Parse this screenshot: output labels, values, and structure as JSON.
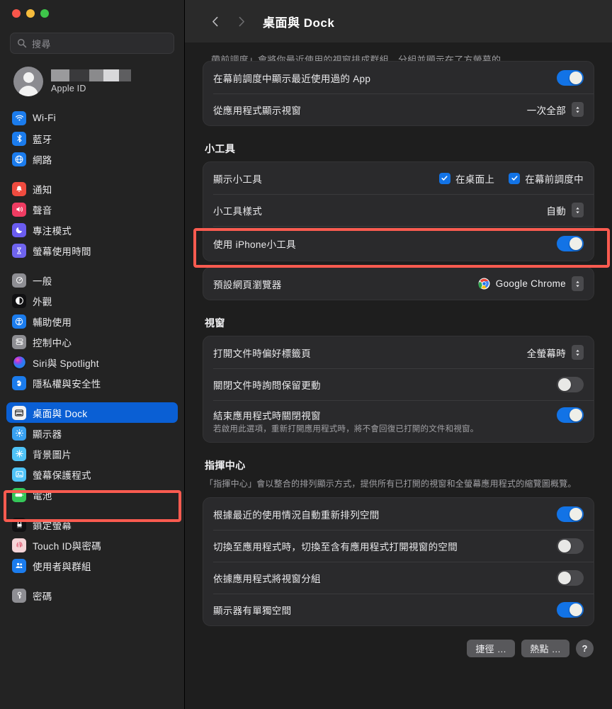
{
  "window": {
    "traffic_lights": [
      "close",
      "minimize",
      "zoom"
    ]
  },
  "sidebar": {
    "search": {
      "placeholder": "搜尋",
      "icon": "search-icon"
    },
    "account": {
      "name_redacted": true,
      "subtitle": "Apple ID"
    },
    "groups": [
      {
        "items": [
          {
            "label": "Wi-Fi",
            "icon": "wifi-icon",
            "color": "#1b7ced"
          },
          {
            "label": "藍牙",
            "icon": "bluetooth-icon",
            "color": "#1b7ced"
          },
          {
            "label": "網路",
            "icon": "network-globe-icon",
            "color": "#1b7ced"
          }
        ]
      },
      {
        "items": [
          {
            "label": "通知",
            "icon": "notifications-bell-icon",
            "color": "#ef4b3f"
          },
          {
            "label": "聲音",
            "icon": "sound-speaker-icon",
            "color": "#ef3c62"
          },
          {
            "label": "專注模式",
            "icon": "focus-moon-icon",
            "color": "#6a5cf0"
          },
          {
            "label": "螢幕使用時間",
            "icon": "screen-time-hourglass-icon",
            "color": "#6f64ef"
          }
        ]
      },
      {
        "items": [
          {
            "label": "一般",
            "icon": "general-gear-icon",
            "color": "#8e8e93"
          },
          {
            "label": "外觀",
            "icon": "appearance-contrast-icon",
            "color": "#111113"
          },
          {
            "label": "輔助使用",
            "icon": "accessibility-icon",
            "color": "#1b7ced"
          },
          {
            "label": "控制中心",
            "icon": "control-center-icon",
            "color": "#8e8e93"
          },
          {
            "label": "Siri與 Spotlight",
            "icon": "siri-icon",
            "color": "#b93ab5"
          },
          {
            "label": "隱私權與安全性",
            "icon": "privacy-hand-icon",
            "color": "#1b7ced"
          }
        ]
      },
      {
        "items": [
          {
            "label": "桌面與 Dock",
            "icon": "desktop-dock-icon",
            "color": "#1c1c1e",
            "selected": true
          },
          {
            "label": "顯示器",
            "icon": "displays-icon",
            "color": "#38a0f0"
          },
          {
            "label": "背景圖片",
            "icon": "wallpaper-icon",
            "color": "#4fc3f7"
          },
          {
            "label": "螢幕保護程式",
            "icon": "screensaver-icon",
            "color": "#4fc3f7"
          },
          {
            "label": "電池",
            "icon": "battery-icon",
            "color": "#35c759"
          }
        ]
      },
      {
        "items": [
          {
            "label": "鎖定螢幕",
            "icon": "lock-screen-icon",
            "color": "#111113"
          },
          {
            "label": "Touch ID與密碼",
            "icon": "touch-id-icon",
            "color": "#f4c9cb"
          },
          {
            "label": "使用者與群組",
            "icon": "users-groups-icon",
            "color": "#1b7ced"
          }
        ]
      },
      {
        "items": [
          {
            "label": "密碼",
            "icon": "passwords-key-icon",
            "color": "#8e8e93"
          }
        ]
      }
    ]
  },
  "header": {
    "back_icon": "chevron-left-icon",
    "forward_icon": "chevron-right-icon",
    "title": "桌面與 Dock"
  },
  "main": {
    "clipped_top_text": "帶前調度」會將你最近使用的視窗排成群組，分組並顯示在了方螢幕的",
    "stage_manager_card": {
      "rows": [
        {
          "label": "在幕前調度中顯示最近使用過的 App",
          "control": "toggle",
          "state": "on"
        },
        {
          "label": "從應用程式顯示視窗",
          "control": "popup",
          "value": "一次全部"
        }
      ]
    },
    "widgets_section": {
      "title": "小工具",
      "rows": [
        {
          "label": "顯示小工具",
          "control": "checkboxes",
          "checkboxes": [
            {
              "label": "在桌面上",
              "checked": true
            },
            {
              "label": "在幕前調度中",
              "checked": true
            }
          ]
        },
        {
          "label": "小工具樣式",
          "control": "popup",
          "value": "自動"
        },
        {
          "label": "使用 iPhone小工具",
          "control": "toggle",
          "state": "on",
          "highlighted": true
        }
      ]
    },
    "browser_card": {
      "rows": [
        {
          "label": "預設網頁瀏覽器",
          "control": "popup",
          "value": "Google Chrome",
          "icon": "chrome-icon"
        }
      ]
    },
    "window_section": {
      "title": "視窗",
      "rows": [
        {
          "label": "打開文件時偏好標籤頁",
          "control": "popup",
          "value": "全螢幕時"
        },
        {
          "label": "關閉文件時詢問保留更動",
          "control": "toggle",
          "state": "off"
        },
        {
          "label": "結束應用程式時關閉視窗",
          "control": "toggle",
          "state": "on",
          "description": "若啟用此選項，重新打開應用程式時，將不會回復已打開的文件和視窗。"
        }
      ]
    },
    "mission_control_section": {
      "title": "指揮中心",
      "description": "「指揮中心」會以整合的排列顯示方式，提供所有已打開的視窗和全螢幕應用程式的縮覽圖概覽。",
      "rows": [
        {
          "label": "根據最近的使用情況自動重新排列空間",
          "control": "toggle",
          "state": "on"
        },
        {
          "label": "切換至應用程式時，切換至含有應用程式打開視窗的空間",
          "control": "toggle",
          "state": "off"
        },
        {
          "label": "依據應用程式將視窗分組",
          "control": "toggle",
          "state": "off"
        },
        {
          "label": "顯示器有單獨空間",
          "control": "toggle",
          "state": "on"
        }
      ]
    },
    "footer": {
      "shortcuts_button": "捷徑 …",
      "hot_corners_button": "熱點 …",
      "help_button": "?"
    }
  },
  "annotations": {
    "color": "#fa5b50",
    "boxes": [
      {
        "target": "sidebar-item-desktop-dock"
      },
      {
        "target": "row-use-iphone-widgets"
      }
    ]
  }
}
